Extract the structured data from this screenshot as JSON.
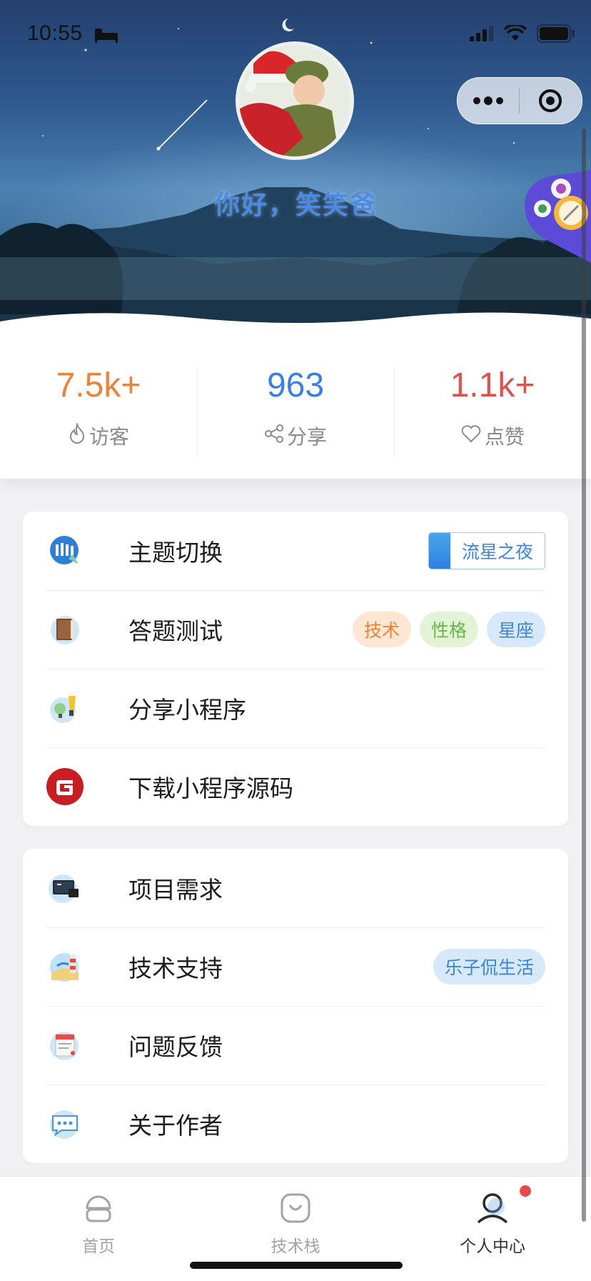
{
  "status_bar": {
    "time": "10:55"
  },
  "header": {
    "greeting": "你好，笑笑爸"
  },
  "stats": [
    {
      "value": "7.5k+",
      "label": "访客",
      "color": "#e8843c",
      "icon": "fire-icon"
    },
    {
      "value": "963",
      "label": "分享",
      "color": "#3b7fe0",
      "icon": "share-icon"
    },
    {
      "value": "1.1k+",
      "label": "点赞",
      "color": "#d9534f",
      "icon": "heart-icon"
    }
  ],
  "menu_group_1": [
    {
      "label": "主题切换",
      "icon": "theme-switch-icon",
      "theme_tag": "流星之夜"
    },
    {
      "label": "答题测试",
      "icon": "quiz-book-icon",
      "tags": [
        "技术",
        "性格",
        "星座"
      ]
    },
    {
      "label": "分享小程序",
      "icon": "lightbulb-share-icon"
    },
    {
      "label": "下载小程序源码",
      "icon": "gitee-logo-icon"
    }
  ],
  "menu_group_2": [
    {
      "label": "项目需求",
      "icon": "project-laptop-icon"
    },
    {
      "label": "技术支持",
      "icon": "lighthouse-support-icon",
      "tag": "乐子侃生活"
    },
    {
      "label": "问题反馈",
      "icon": "feedback-form-icon"
    },
    {
      "label": "关于作者",
      "icon": "chat-bubble-icon"
    }
  ],
  "tag_colors": {
    "tech": {
      "bg": "#fde6d4",
      "fg": "#e8843c"
    },
    "personality": {
      "bg": "#e3f3d6",
      "fg": "#6bb54a"
    },
    "zodiac": {
      "bg": "#d8e8fb",
      "fg": "#3b86d8"
    },
    "support": {
      "bg": "#d8e8fb",
      "fg": "#3b86d8"
    }
  },
  "tabbar": [
    {
      "label": "首页",
      "icon": "home-icon",
      "active": false
    },
    {
      "label": "技术栈",
      "icon": "tech-stack-icon",
      "active": false
    },
    {
      "label": "个人中心",
      "icon": "user-icon",
      "active": true
    }
  ]
}
